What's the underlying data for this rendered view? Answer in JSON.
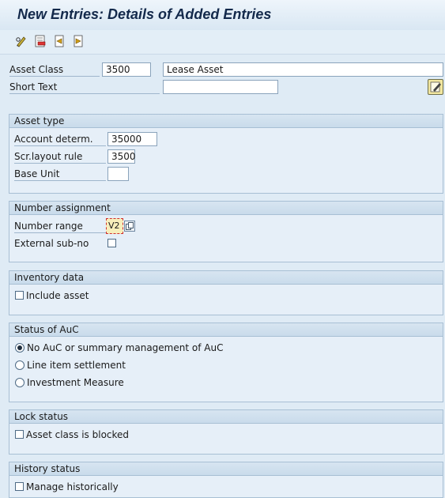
{
  "header": {
    "title": "New Entries: Details of Added Entries"
  },
  "toolbar": {
    "icons": [
      "pencil-glasses-icon",
      "delete-icon",
      "previous-entry-icon",
      "next-entry-icon"
    ]
  },
  "top": {
    "asset_class_label": "Asset Class",
    "asset_class_value": "3500",
    "asset_class_description": "Lease Asset",
    "short_text_label": "Short Text",
    "short_text_value": ""
  },
  "asset_type": {
    "title": "Asset type",
    "account_determ_label": "Account determ.",
    "account_determ_value": "35000",
    "scr_layout_label": "Scr.layout rule",
    "scr_layout_value": "3500",
    "base_unit_label": "Base Unit",
    "base_unit_value": ""
  },
  "number_assignment": {
    "title": "Number assignment",
    "number_range_label": "Number range",
    "number_range_value": "V2",
    "external_sub_no_label": "External sub-no",
    "external_sub_no_checked": false
  },
  "inventory_data": {
    "title": "Inventory data",
    "include_asset_label": "Include asset",
    "include_asset_checked": false
  },
  "status_auc": {
    "title": "Status of AuC",
    "options": [
      {
        "label": "No AuC or summary management of AuC",
        "selected": true
      },
      {
        "label": "Line item settlement",
        "selected": false
      },
      {
        "label": "Investment Measure",
        "selected": false
      }
    ]
  },
  "lock_status": {
    "title": "Lock status",
    "blocked_label": "Asset class is blocked",
    "blocked_checked": false
  },
  "history_status": {
    "title": "History status",
    "manage_label": "Manage historically",
    "manage_checked": false
  },
  "colors": {
    "background": "#dfebf5",
    "group_header": "#c9dbeb",
    "title_text": "#13294b",
    "required_field": "#f7eebb",
    "required_border": "#d03030"
  }
}
